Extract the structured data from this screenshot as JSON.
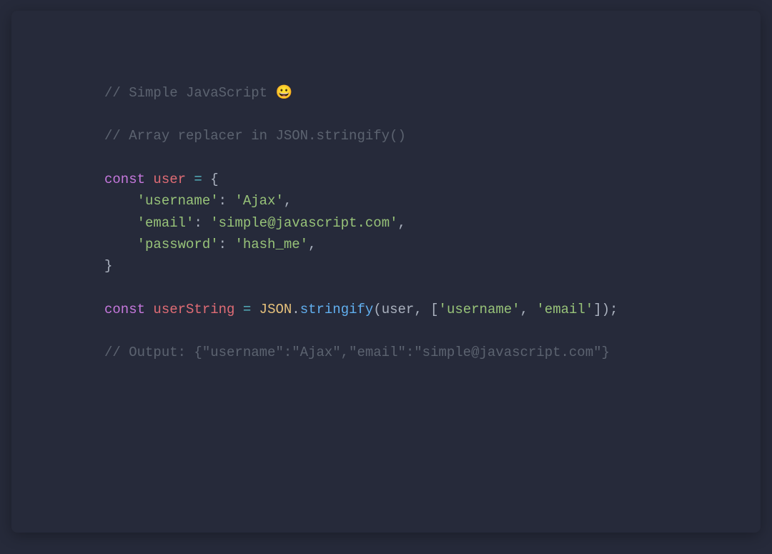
{
  "code": {
    "c1_prefix": "// Simple JavaScript ",
    "c1_emoji": "😀",
    "c2": "// Array replacer in JSON.stringify()",
    "kw_const": "const",
    "sp": " ",
    "var_user": "user",
    "eq": " = ",
    "brace_open": "{",
    "indent": "    ",
    "key_username": "'username'",
    "colon": ": ",
    "val_ajax": "'Ajax'",
    "comma": ",",
    "key_email": "'email'",
    "val_email": "'simple@javascript.com'",
    "key_password": "'password'",
    "val_hash": "'hash_me'",
    "brace_close": "}",
    "var_userString": "userString",
    "cls_json": "JSON",
    "dot": ".",
    "fn_stringify": "stringify",
    "paren_open": "(",
    "arg_user": "user",
    "arg_sep": ", ",
    "bracket_open": "[",
    "arr_username": "'username'",
    "arr_email": "'email'",
    "bracket_close": "]",
    "paren_close": ")",
    "semi": ";",
    "c3": "// Output: {\"username\":\"Ajax\",\"email\":\"simple@javascript.com\"}"
  }
}
